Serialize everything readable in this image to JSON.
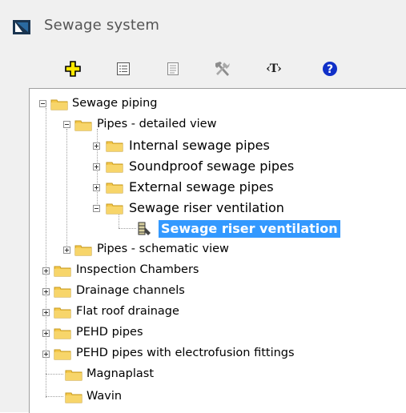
{
  "window": {
    "title": "Sewage system",
    "icon": "app-window-icon"
  },
  "toolbar": {
    "buttons": [
      {
        "name": "add",
        "icon": "yellow-plus-icon"
      },
      {
        "name": "properties",
        "icon": "list-dialog-icon"
      },
      {
        "name": "document",
        "icon": "document-icon"
      },
      {
        "name": "tools",
        "icon": "hammer-wrench-icon"
      },
      {
        "name": "text",
        "label": "‹T›"
      },
      {
        "name": "help",
        "icon": "help-icon"
      }
    ]
  },
  "tree": {
    "items": [
      {
        "label": "Sewage piping",
        "state": "expanded"
      },
      {
        "label": "Pipes - detailed view",
        "state": "expanded"
      },
      {
        "label": "Internal sewage pipes",
        "state": "collapsed"
      },
      {
        "label": "Soundproof sewage pipes",
        "state": "collapsed"
      },
      {
        "label": "External sewage pipes",
        "state": "collapsed"
      },
      {
        "label": "Sewage riser ventilation",
        "state": "expanded"
      },
      {
        "label": "Sewage riser ventilation",
        "state": "selected"
      },
      {
        "label": "Pipes - schematic view",
        "state": "collapsed"
      },
      {
        "label": "Inspection Chambers",
        "state": "collapsed"
      },
      {
        "label": "Drainage channels",
        "state": "collapsed"
      },
      {
        "label": "Flat roof drainage",
        "state": "collapsed"
      },
      {
        "label": "PEHD pipes",
        "state": "collapsed"
      },
      {
        "label": "PEHD pipes with electrofusion fittings",
        "state": "collapsed"
      },
      {
        "label": "Magnaplast",
        "state": "leaf"
      },
      {
        "label": "Wavin",
        "state": "leaf"
      }
    ]
  },
  "colors": {
    "selection": "#3399ff",
    "folder": "#f5c84a",
    "help": "#1030c8"
  }
}
